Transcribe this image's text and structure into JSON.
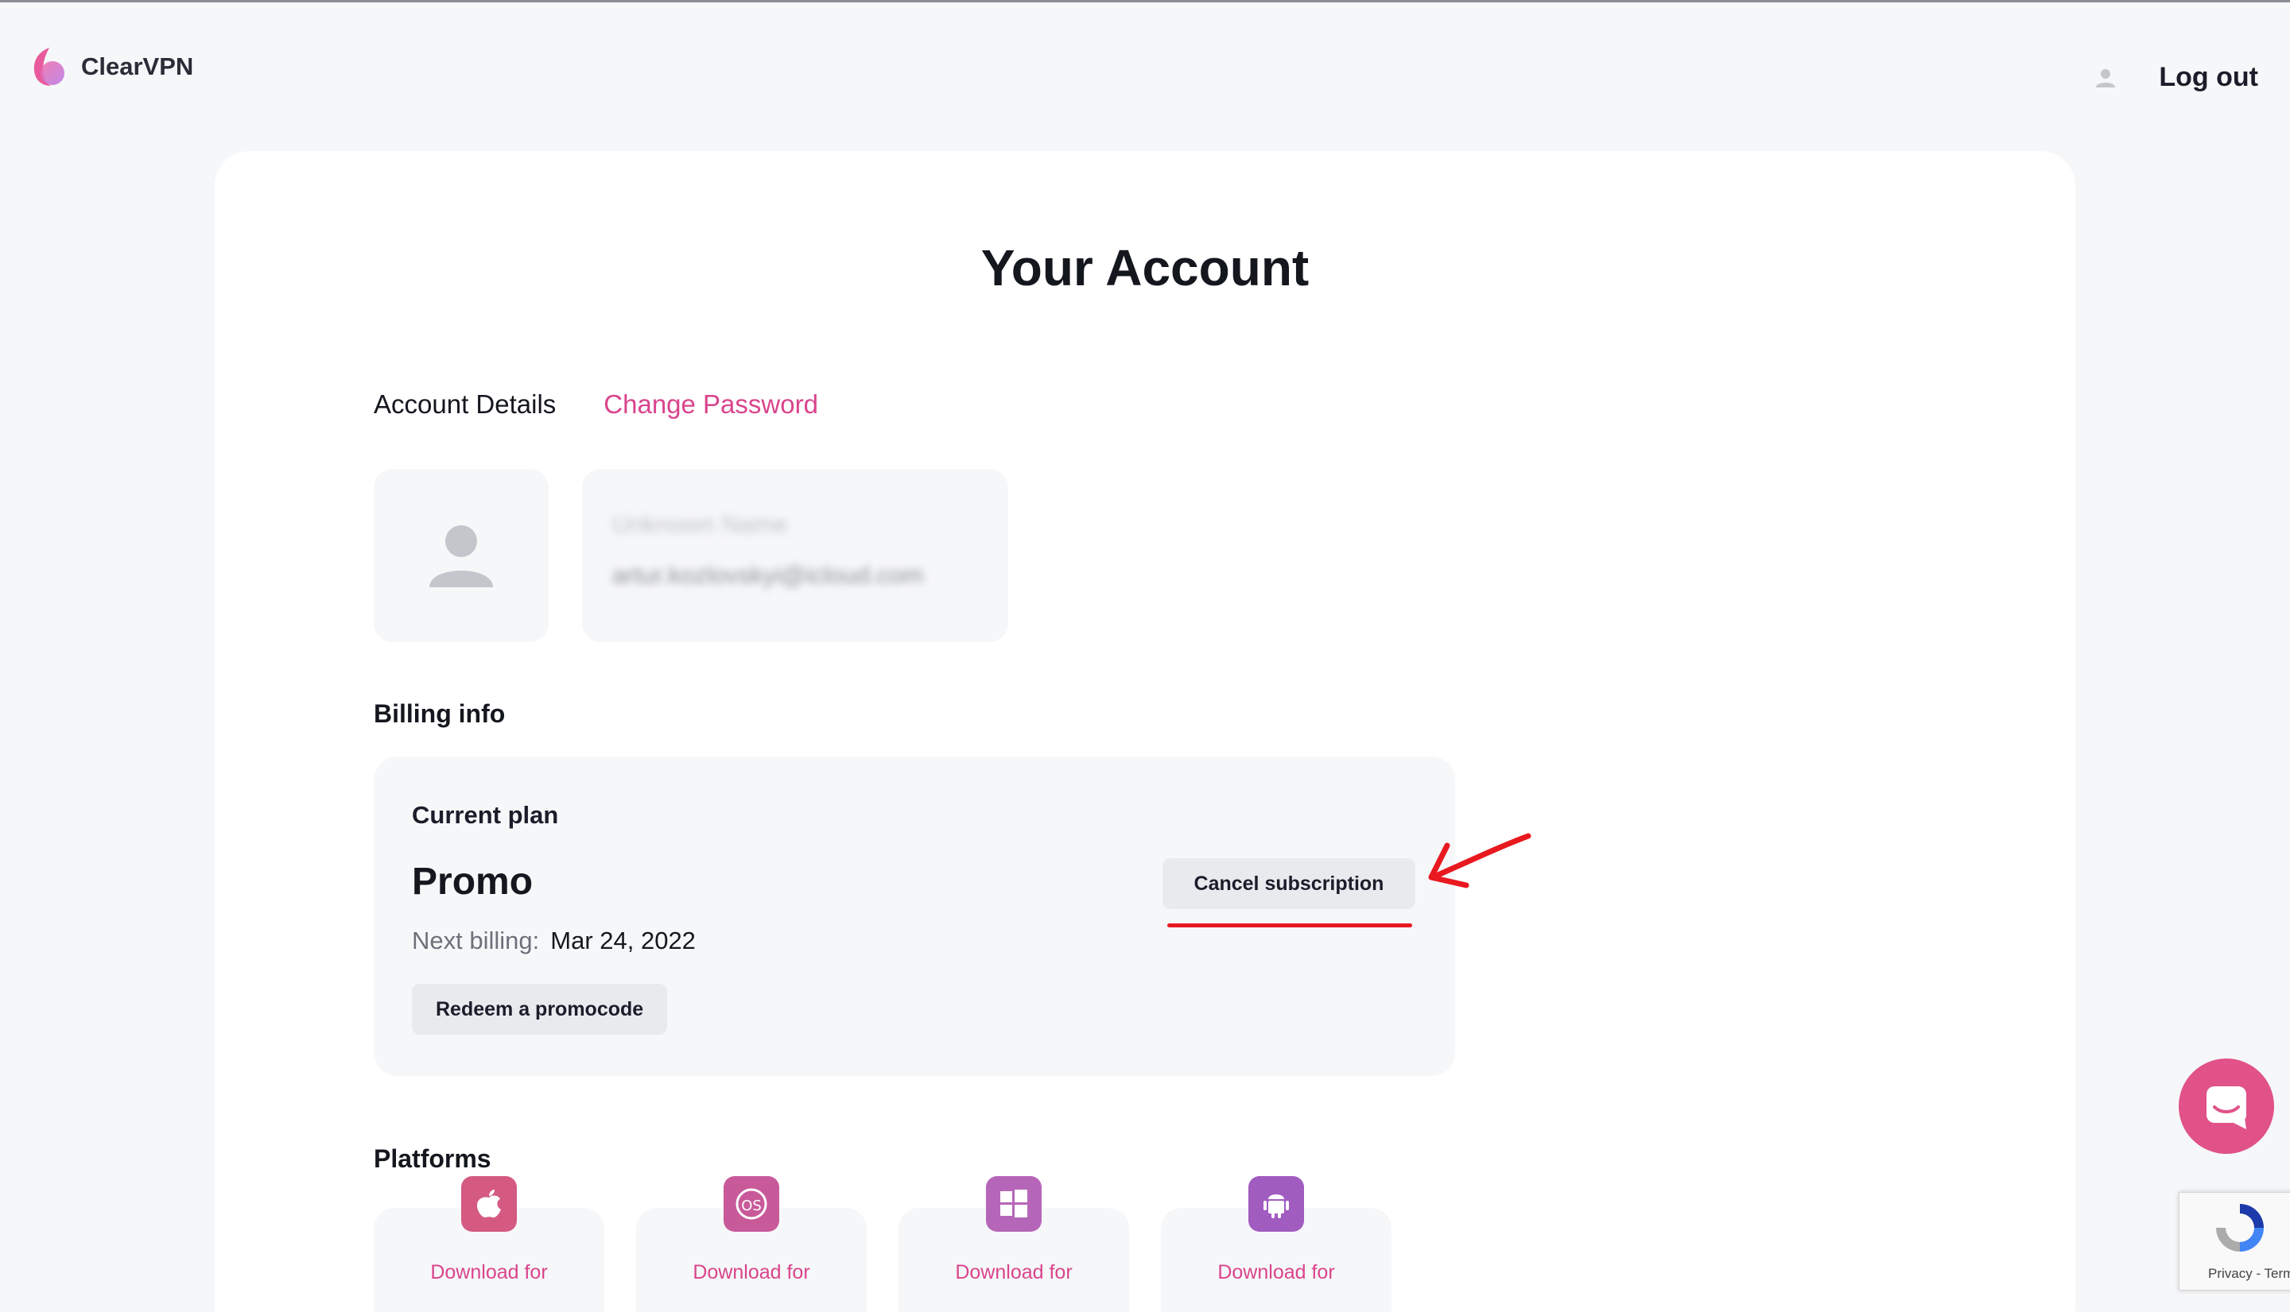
{
  "header": {
    "brand": "ClearVPN",
    "logout_label": "Log out"
  },
  "page": {
    "title": "Your Account"
  },
  "tabs": {
    "account_details": "Account Details",
    "change_password": "Change Password"
  },
  "profile": {
    "name": "Unknown Name",
    "email": "artur.kozlovskyi@icloud.com"
  },
  "billing": {
    "section_title": "Billing info",
    "current_plan_label": "Current plan",
    "plan_name": "Promo",
    "next_billing_label": "Next billing:",
    "next_billing_date": "Mar 24, 2022",
    "redeem_label": "Redeem a promocode",
    "cancel_label": "Cancel subscription"
  },
  "platforms": {
    "section_title": "Platforms",
    "items": [
      {
        "label": "Download for",
        "icon": "apple-icon",
        "color": "#d45a82"
      },
      {
        "label": "Download for",
        "icon": "macos-icon",
        "color": "#c85a9a"
      },
      {
        "label": "Download for",
        "icon": "windows-icon",
        "color": "#b666b8"
      },
      {
        "label": "Download for",
        "icon": "android-icon",
        "color": "#a15cc0"
      }
    ]
  },
  "recaptcha": {
    "links": "Privacy - Terms"
  },
  "colors": {
    "accent": "#d9448c",
    "annotation_red": "#e8191f",
    "background": "#f6f7f9"
  }
}
